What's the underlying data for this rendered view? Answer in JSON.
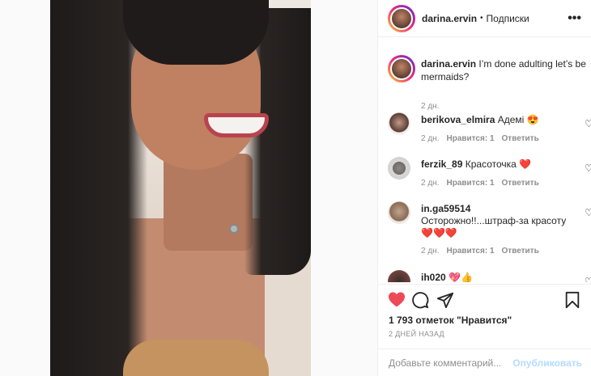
{
  "header": {
    "username": "darina.ervin",
    "separator": "•",
    "follow_label": "Подписки",
    "more_icon": "more-horizontal-icon"
  },
  "caption": {
    "username": "darina.ervin",
    "text": "I’m done adulting let’s be mermaids?",
    "time": "2 дн."
  },
  "comments": [
    {
      "username": "berikova_elmira",
      "text": "Адемі 😍",
      "time": "2 дн.",
      "likes": "Нравится: 1",
      "reply": "Ответить"
    },
    {
      "username": "ferzik_89",
      "text": "Красоточка ❤️",
      "time": "2 дн.",
      "likes": "Нравится: 1",
      "reply": "Ответить"
    },
    {
      "username": "in.ga59514",
      "text": "Осторожно!!...штраф-за красоту ❤️❤️❤️",
      "time": "2 дн.",
      "likes": "Нравится: 1",
      "reply": "Ответить"
    },
    {
      "username": "ih020",
      "text": "💖👍"
    }
  ],
  "actions": {
    "like_icon": "heart-filled-icon",
    "comment_icon": "comment-icon",
    "share_icon": "share-icon",
    "save_icon": "bookmark-icon",
    "like_color": "#ed4956"
  },
  "likes_text": "1 793 отметок \"Нравится\"",
  "posted_ago": "2 ДНЕЙ НАЗАД",
  "add_comment": {
    "placeholder": "Добавьте комментарий...",
    "publish_label": "Опубликовать"
  }
}
